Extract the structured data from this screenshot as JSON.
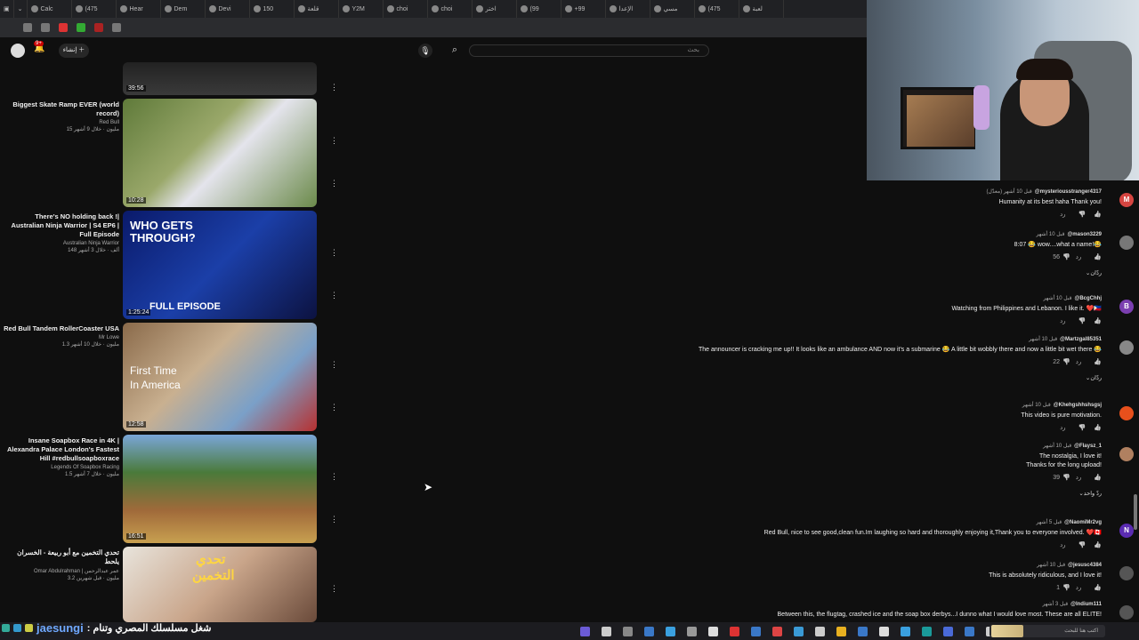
{
  "browser": {
    "tabs": [
      "Calc",
      "(475",
      "Hear",
      "Dem",
      "Devi",
      "150",
      "قلعة",
      "Y2M",
      "choi",
      "choi",
      "اختر",
      "(99",
      "+99",
      "الإعدا",
      "مسي",
      "(475",
      "لعبة"
    ]
  },
  "header": {
    "search_placeholder": "بحث",
    "create_label": "إنشاء",
    "notif_count": "9+"
  },
  "videos": [
    {
      "title": "",
      "channel": "",
      "stats": "",
      "duration": "39:56"
    },
    {
      "title": "Biggest Skate Ramp EVER (world record)",
      "channel": "Red Bull",
      "stats": "15 مليون · خلال 9 أشهر",
      "duration": "10:28"
    },
    {
      "title": "There's NO holding back !| Australian Ninja Warrior | S4 EP6 | Full Episode",
      "channel": "Australian Ninja Warrior",
      "stats": "148 ألف · خلال 3 أشهر",
      "duration": "1:25:24",
      "thumb_text_1": "WHO GETS",
      "thumb_text_2": "THROUGH?",
      "thumb_text_3": "FULL EPISODE"
    },
    {
      "title": "Red Bull Tandem RollerCoaster USA",
      "channel": "Mr Lowe",
      "stats": "1.3 مليون · خلال 10 أشهر",
      "duration": "12:58",
      "thumb_text_1": "First Time",
      "thumb_text_2": "In America"
    },
    {
      "title": "Insane Soapbox Race in 4K | Alexandra Palace London's Fastest Hill #redbullsoapboxrace",
      "channel": "Legends Of Soapbox Racing",
      "stats": "1.5 مليون · خلال 7 أشهر",
      "duration": "16:51"
    },
    {
      "title": "تحدي التخمين مع أبو ربيعة - الخسران يلحط",
      "channel": "Omar Abdulrahman | عمر عبدالرحمن",
      "stats": "3.2 مليون · قبل شهرين",
      "duration": "",
      "thumb_text_1": "تحدي",
      "thumb_text_2": "التخمين"
    }
  ],
  "comments": [
    {
      "author": "@mysteriousstranger4317",
      "time": "قبل 10 أشهر (معدّل)",
      "text": "Humanity at its best haha Thank you!",
      "likes": "",
      "avatar": "M",
      "color": "#d64541"
    },
    {
      "author": "@mason3229",
      "time": "قبل 10 أشهر",
      "text": "8:07 😂 wow....what a name!😂",
      "likes": "56",
      "avatar": "",
      "color": "#777777",
      "replies": "ردّان"
    },
    {
      "author": "@BcgChhj",
      "time": "قبل 10 أشهر",
      "text": "Watching from Philippines and Lebanon. I like it. ❤️🇵🇭",
      "likes": "",
      "avatar": "B",
      "color": "#7b3fb0"
    },
    {
      "author": "@Martzgal85351",
      "time": "قبل 10 أشهر",
      "text": "The announcer is cracking me up!! It looks like an ambulance AND now it's a submarine 😂 A little bit wobbly there and now a little bit wet there 😂",
      "likes": "22",
      "avatar": "",
      "color": "#888888",
      "replies": "ردّان"
    },
    {
      "author": "@Khehgshhshsgsj",
      "time": "قبل 10 أشهر",
      "text": "This video is pure motivation.",
      "likes": "",
      "avatar": "",
      "color": "#e8501c"
    },
    {
      "author": "@Flaysz_1",
      "time": "قبل 10 أشهر",
      "text_1": "The nostalgia, I love it!",
      "text_2": "Thanks for the long upload!",
      "likes": "39",
      "avatar": "",
      "color": "#b08060",
      "replies": "ردّ واحد"
    },
    {
      "author": "@NaomiMr2vg",
      "time": "قبل 5 أشهر",
      "text": "Red Bull, nice to see good,clean fun.Im laughing so hard and thoroughly enjoying it,Thank you to everyone involved. ❤️🇨🇦",
      "likes": "",
      "avatar": "N",
      "color": "#5b2cb2"
    },
    {
      "author": "@jesusc4384",
      "time": "قبل 10 أشهر",
      "text": "This is absolutely ridiculous, and I love it!",
      "likes": "1",
      "avatar": "",
      "color": "#555555"
    },
    {
      "author": "@Indium111",
      "time": "قبل 3 أشهر",
      "text": "Between this, the flugtag, crashed ice and the soap box derbys...I dunno what I would love most.  These are all ELITE!",
      "likes": "",
      "avatar": "",
      "color": "#555555"
    }
  ],
  "reply_label": "رد",
  "overlay": {
    "username": "jaesungi",
    "message": ": شغل مسلسلك المصري وتنام"
  },
  "taskbar": {
    "search_placeholder": "اكتب هنا للبحث"
  }
}
